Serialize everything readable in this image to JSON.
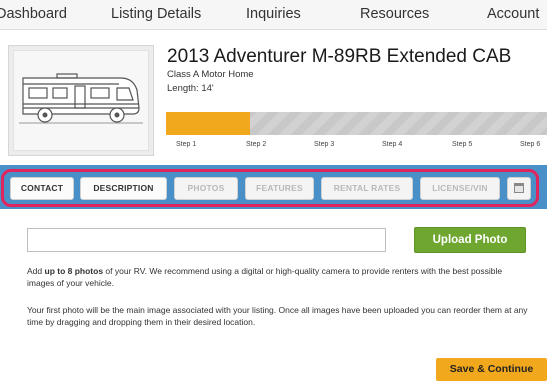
{
  "nav": {
    "items": [
      "Dashboard",
      "Listing Details",
      "Inquiries",
      "Resources",
      "Account"
    ]
  },
  "listing": {
    "title": "2013 Adventurer M-89RB Extended CAB",
    "type": "Class A Motor Home",
    "length": "Length: 14'"
  },
  "progress": {
    "fraction": 0.22,
    "fill_color": "#f2a81d",
    "steps": [
      "Step 1",
      "Step 2",
      "Step 3",
      "Step 4",
      "Step 5",
      "Step 6"
    ]
  },
  "tabs": [
    {
      "label": "CONTACT",
      "state": "active"
    },
    {
      "label": "DESCRIPTION",
      "state": "active"
    },
    {
      "label": "PHOTOS",
      "state": "disabled"
    },
    {
      "label": "FEATURES",
      "state": "disabled"
    },
    {
      "label": "RENTAL RATES",
      "state": "disabled"
    },
    {
      "label": "LICENSE/VIN",
      "state": "disabled"
    },
    {
      "label": "",
      "icon": "calendar-icon",
      "state": "disabled"
    }
  ],
  "upload": {
    "input_value": "",
    "button_label": "Upload Photo",
    "intro_prefix": "Add ",
    "intro_bold": "up to 8 photos",
    "intro_suffix": " of your RV. We recommend using a digital or high-quality camera to provide renters with the best possible images of your vehicle.",
    "note": "Your first photo will be the main image associated with your listing. Once all images have been uploaded you can reorder them at any time by dragging and dropping them in their desired location."
  },
  "footer": {
    "save_label": "Save & Continue"
  },
  "colors": {
    "tab_band": "#4a90c8",
    "highlight_frame": "#e0245e",
    "upload_button": "#6fa630",
    "save_button": "#f2a81d"
  }
}
